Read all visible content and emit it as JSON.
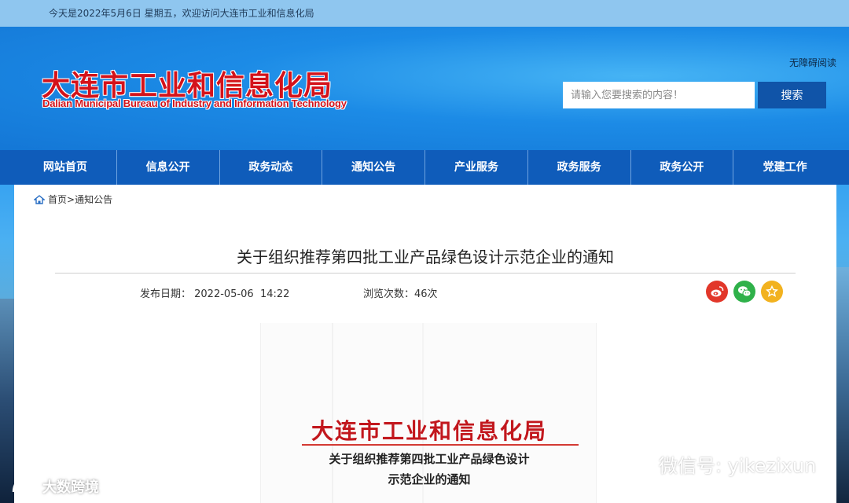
{
  "topbar": {
    "greeting": "今天是2022年5月6日 星期五，欢迎访问大连市工业和信息化局"
  },
  "header": {
    "logo_cn": "大连市工业和信息化局",
    "logo_en": "Dalian Municipal Bureau of Industry and Information Technology",
    "accessible_label": "无障碍阅读",
    "search_placeholder": "请输入您要搜索的内容！",
    "search_button": "搜索"
  },
  "nav": {
    "items": [
      {
        "label": "网站首页"
      },
      {
        "label": "信息公开"
      },
      {
        "label": "政务动态"
      },
      {
        "label": "通知公告"
      },
      {
        "label": "产业服务"
      },
      {
        "label": "政务服务"
      },
      {
        "label": "政务公开"
      },
      {
        "label": "党建工作"
      }
    ]
  },
  "breadcrumb": {
    "home": "首页",
    "separator": ">",
    "current": "通知公告"
  },
  "article": {
    "title": "关于组织推荐第四批工业产品绿色设计示范企业的通知",
    "publish_date": "发布日期： 2022-05-06  14:22",
    "views": "浏览次数：46次",
    "share_icons": [
      "weibo-icon",
      "wechat-icon",
      "favorite-icon"
    ]
  },
  "document": {
    "org_name": "大连市工业和信息化局",
    "subtitle_line1": "关于组织推荐第四批工业产品绿色设计",
    "subtitle_line2": "示范企业的通知"
  },
  "watermarks": {
    "wechat": "微信号: yikezixun",
    "bigdata": "大数跨境"
  },
  "colors": {
    "nav_bg": "#0f5cba",
    "logo_red": "#d4131b",
    "search_button_bg": "#1054a8"
  }
}
